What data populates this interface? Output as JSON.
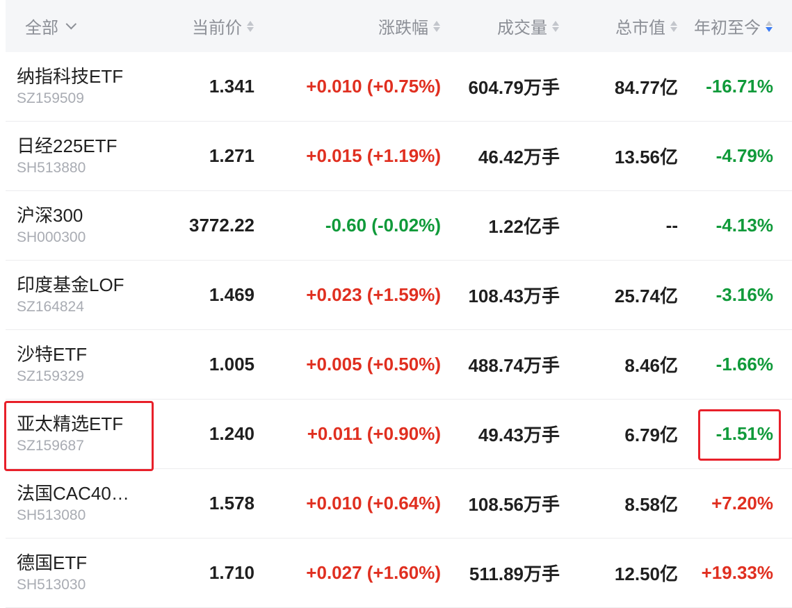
{
  "header": {
    "col_all": "全部",
    "col_price": "当前价",
    "col_change": "涨跌幅",
    "col_volume": "成交量",
    "col_mktcap": "总市值",
    "col_ytd": "年初至今"
  },
  "rows": [
    {
      "name": "纳指科技ETF",
      "code": "SZ159509",
      "price": "1.341",
      "change": "+0.010 (+0.75%)",
      "change_dir": "up",
      "volume": "604.79万手",
      "mktcap": "84.77亿",
      "ytd": "-16.71%",
      "ytd_dir": "down"
    },
    {
      "name": "日经225ETF",
      "code": "SH513880",
      "price": "1.271",
      "change": "+0.015 (+1.19%)",
      "change_dir": "up",
      "volume": "46.42万手",
      "mktcap": "13.56亿",
      "ytd": "-4.79%",
      "ytd_dir": "down"
    },
    {
      "name": "沪深300",
      "code": "SH000300",
      "price": "3772.22",
      "change": "-0.60 (-0.02%)",
      "change_dir": "down",
      "volume": "1.22亿手",
      "mktcap": "--",
      "ytd": "-4.13%",
      "ytd_dir": "down"
    },
    {
      "name": "印度基金LOF",
      "code": "SZ164824",
      "price": "1.469",
      "change": "+0.023 (+1.59%)",
      "change_dir": "up",
      "volume": "108.43万手",
      "mktcap": "25.74亿",
      "ytd": "-3.16%",
      "ytd_dir": "down"
    },
    {
      "name": "沙特ETF",
      "code": "SZ159329",
      "price": "1.005",
      "change": "+0.005 (+0.50%)",
      "change_dir": "up",
      "volume": "488.74万手",
      "mktcap": "8.46亿",
      "ytd": "-1.66%",
      "ytd_dir": "down"
    },
    {
      "name": "亚太精选ETF",
      "code": "SZ159687",
      "price": "1.240",
      "change": "+0.011 (+0.90%)",
      "change_dir": "up",
      "volume": "49.43万手",
      "mktcap": "6.79亿",
      "ytd": "-1.51%",
      "ytd_dir": "down"
    },
    {
      "name": "法国CAC40…",
      "code": "SH513080",
      "price": "1.578",
      "change": "+0.010 (+0.64%)",
      "change_dir": "up",
      "volume": "108.56万手",
      "mktcap": "8.58亿",
      "ytd": "+7.20%",
      "ytd_dir": "up"
    },
    {
      "name": "德国ETF",
      "code": "SH513030",
      "price": "1.710",
      "change": "+0.027 (+1.60%)",
      "change_dir": "up",
      "volume": "511.89万手",
      "mktcap": "12.50亿",
      "ytd": "+19.33%",
      "ytd_dir": "up"
    }
  ],
  "colors": {
    "up": "#e02f20",
    "down": "#109a3a",
    "highlight": "#e8202a",
    "active_sort": "#3b7cf5"
  },
  "icons": {
    "filter": "chevron-down-icon",
    "sort": "sort-arrows-icon"
  },
  "sort": {
    "column": "ytd",
    "direction": "descending"
  },
  "highlighted_row": 5
}
